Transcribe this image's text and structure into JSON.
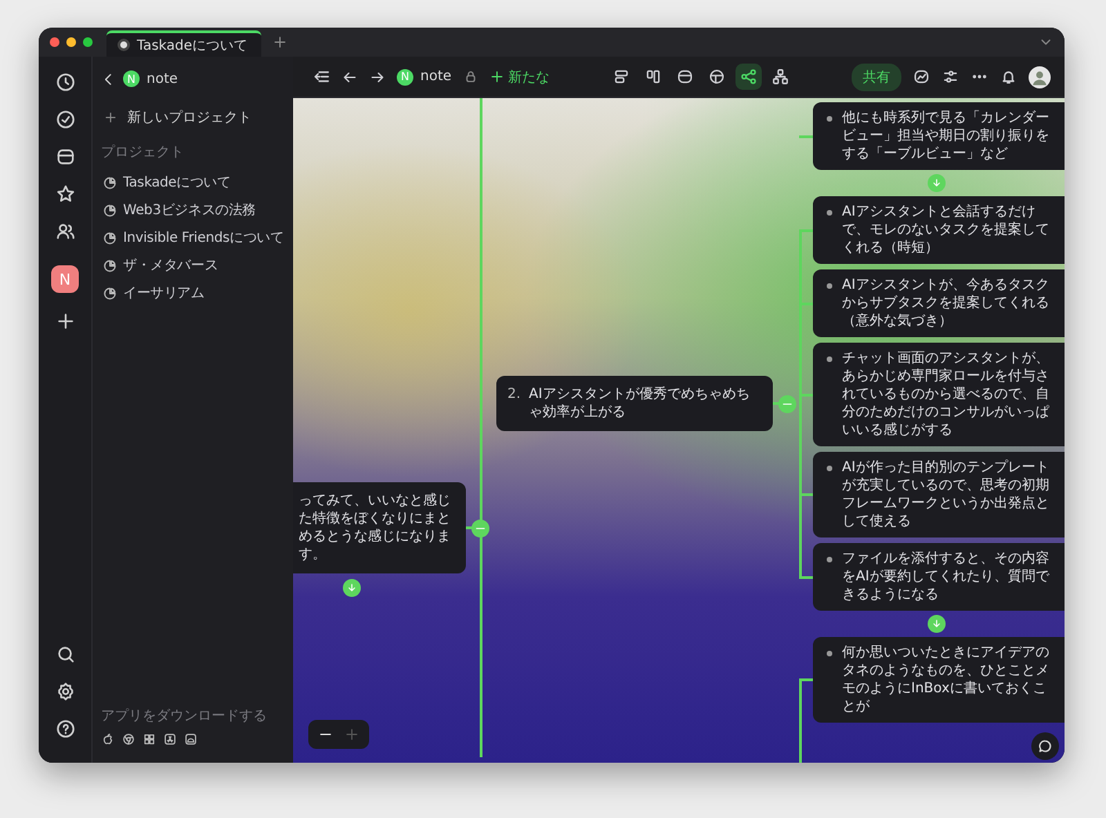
{
  "tabs": [
    {
      "title": "Taskadeについて",
      "selected": true
    }
  ],
  "rail": {
    "workspace_letter": "N"
  },
  "sidebar": {
    "workspace": {
      "letter": "N",
      "name": "note"
    },
    "new_project": "新しいプロジェクト",
    "section_label": "プロジェクト",
    "projects": [
      {
        "name": "Taskadeについて"
      },
      {
        "name": "Web3ビジネスの法務"
      },
      {
        "name": "Invisible Friendsについて"
      },
      {
        "name": "ザ・メタバース"
      },
      {
        "name": "イーサリアム"
      }
    ],
    "download_label": "アプリをダウンロードする"
  },
  "toolbar": {
    "project": {
      "letter": "N",
      "name": "note"
    },
    "new_button": "新たな",
    "view_modes": [
      {
        "selected": false
      },
      {
        "selected": false
      },
      {
        "selected": false
      },
      {
        "selected": false
      },
      {
        "selected": true
      },
      {
        "selected": false
      }
    ],
    "share_button": "共有"
  },
  "mindmap": {
    "left_node": {
      "text": "ってみて、いいなと感じた特徴をぼくなりにまとめるとうな感じになります。"
    },
    "center_node": {
      "number": "2.",
      "text": "AIアシスタントが優秀でめちゃめちゃ効率が上がる"
    },
    "top_node": {
      "text": "他にも時系列で見る「カレンダービュー」担当や期日の割り振りをする「ーブルビュー」など"
    },
    "child_nodes": [
      {
        "text": "AIアシスタントと会話するだけで、モレのないタスクを提案してくれる（時短）"
      },
      {
        "text": "AIアシスタントが、今あるタスクからサブタスクを提案してくれる（意外な気づき）"
      },
      {
        "text": "チャット画面のアシスタントが、あらかじめ専門家ロールを付与されているものから選べるので、自分のためだけのコンサルがいっぱいいる感じがする"
      },
      {
        "text": "AIが作った目的別のテンプレートが充実しているので、思考の初期フレームワークというか出発点として使える"
      },
      {
        "text": "ファイルを添付すると、その内容をAIが要約してくれたり、質問できるようになる"
      }
    ],
    "bottom_node": {
      "text": "何か思いついたときにアイデアのタネのようなものを、ひとことメモのようにInBoxに書いておくことが"
    }
  },
  "zoom_controls": [
    {
      "disabled": false
    },
    {
      "disabled": true
    }
  ]
}
